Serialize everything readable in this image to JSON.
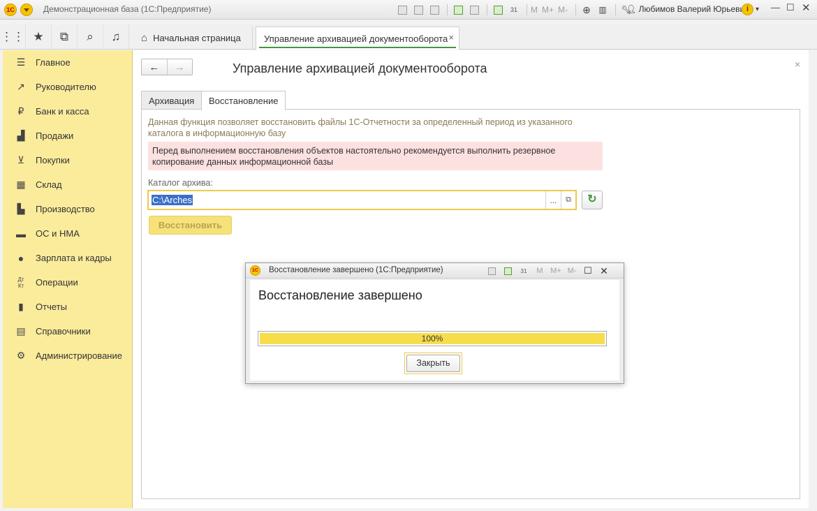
{
  "window": {
    "title": "Демонстрационная база  (1С:Предприятие)",
    "user": "Любимов Валерий Юрьевич",
    "mem_labels": [
      "M",
      "M+",
      "M-"
    ]
  },
  "topnav": {
    "home_tab": "Начальная страница",
    "active_tab": "Управление архивацией документооборота",
    "close_glyph": "×"
  },
  "sidebar": {
    "items": [
      {
        "label": "Главное",
        "icon": "menu-icon"
      },
      {
        "label": "Руководителю",
        "icon": "trend-icon"
      },
      {
        "label": "Банк и касса",
        "icon": "ruble-icon"
      },
      {
        "label": "Продажи",
        "icon": "bag-icon"
      },
      {
        "label": "Покупки",
        "icon": "cart-icon"
      },
      {
        "label": "Склад",
        "icon": "warehouse-icon"
      },
      {
        "label": "Производство",
        "icon": "factory-icon"
      },
      {
        "label": "ОС и НМА",
        "icon": "truck-icon"
      },
      {
        "label": "Зарплата и кадры",
        "icon": "person-icon"
      },
      {
        "label": "Операции",
        "icon": "dt-kt-icon"
      },
      {
        "label": "Отчеты",
        "icon": "bar-chart-icon"
      },
      {
        "label": "Справочники",
        "icon": "book-icon"
      },
      {
        "label": "Администрирование",
        "icon": "gear-icon"
      }
    ]
  },
  "form": {
    "title": "Управление архивацией документооборота",
    "tabs": [
      "Архивация",
      "Восстановление"
    ],
    "description": "Данная функция позволяет восстановить файлы 1С-Отчетности за определенный период из указанного каталога в информационную базу",
    "warning": "Перед выполнением восстановления объектов настоятельно рекомендуется выполнить резервное копирование данных информационной базы",
    "catalog_label": "Каталог архива:",
    "catalog_value": "C:\\Arches",
    "dots": "...",
    "restore_button": "Восстановить"
  },
  "dialog": {
    "window_title": "Восстановление завершено  (1С:Предприятие)",
    "heading": "Восстановление завершено",
    "progress": 1.0,
    "progress_label": "100%",
    "close_button": "Закрыть"
  },
  "colors": {
    "sidebar_bg": "#fbec9c",
    "progress_fill": "#f7dd4c",
    "warning_bg": "#fde1e1",
    "focus_border": "#f1c84a",
    "accent_green": "#3f9a3a"
  }
}
